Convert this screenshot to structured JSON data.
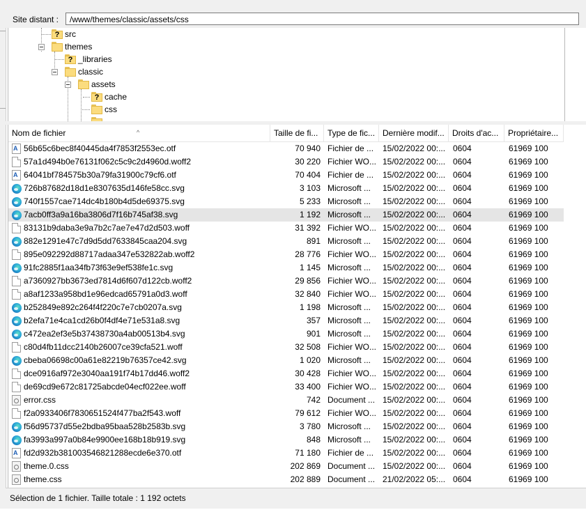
{
  "path_bar": {
    "label": "Site distant :",
    "path": "/www/themes/classic/assets/css"
  },
  "tree": [
    {
      "label": "src",
      "unknown": true
    },
    {
      "label": "themes",
      "unknown": false
    },
    {
      "label": "_libraries",
      "unknown": true
    },
    {
      "label": "classic",
      "unknown": false
    },
    {
      "label": "assets",
      "unknown": false
    },
    {
      "label": "cache",
      "unknown": true
    },
    {
      "label": "css",
      "unknown": false
    }
  ],
  "columns": {
    "name": "Nom de fichier",
    "size": "Taille de fi...",
    "type": "Type de fic...",
    "modified": "Dernière modif...",
    "permissions": "Droits d'ac...",
    "owner": "Propriétaire..."
  },
  "files": [
    {
      "name": "56b65c6bec8f40445da4f7853f2553ec.otf",
      "size": "70 940",
      "type": "Fichier de ...",
      "modified": "15/02/2022 00:...",
      "permissions": "0604",
      "owner": "61969 100",
      "icon": "font-file-icon"
    },
    {
      "name": "57a1d494b0e76131f062c5c9c2d4960d.woff2",
      "size": "30 220",
      "type": "Fichier WO...",
      "modified": "15/02/2022 00:...",
      "permissions": "0604",
      "owner": "61969 100",
      "icon": "document-file-icon"
    },
    {
      "name": "64041bf784575b30a79fa31900c79cf6.otf",
      "size": "70 404",
      "type": "Fichier de ...",
      "modified": "15/02/2022 00:...",
      "permissions": "0604",
      "owner": "61969 100",
      "icon": "font-file-icon"
    },
    {
      "name": "726b87682d18d1e8307635d146fe58cc.svg",
      "size": "3 103",
      "type": "Microsoft ...",
      "modified": "15/02/2022 00:...",
      "permissions": "0604",
      "owner": "61969 100",
      "icon": "edge-browser-icon"
    },
    {
      "name": "740f1557cae714dc4b180b4d5de69375.svg",
      "size": "5 233",
      "type": "Microsoft ...",
      "modified": "15/02/2022 00:...",
      "permissions": "0604",
      "owner": "61969 100",
      "icon": "edge-browser-icon"
    },
    {
      "name": "7acb0ff3a9a16ba3806d7f16b745af38.svg",
      "size": "1 192",
      "type": "Microsoft ...",
      "modified": "15/02/2022 00:...",
      "permissions": "0604",
      "owner": "61969 100",
      "icon": "edge-browser-icon",
      "selected": true
    },
    {
      "name": "83131b9daba3e9a7b2c7ae7e47d2d503.woff",
      "size": "31 392",
      "type": "Fichier WO...",
      "modified": "15/02/2022 00:...",
      "permissions": "0604",
      "owner": "61969 100",
      "icon": "document-file-icon"
    },
    {
      "name": "882e1291e47c7d9d5dd7633845caa204.svg",
      "size": "891",
      "type": "Microsoft ...",
      "modified": "15/02/2022 00:...",
      "permissions": "0604",
      "owner": "61969 100",
      "icon": "edge-browser-icon"
    },
    {
      "name": "895e092292d88717adaa347e532822ab.woff2",
      "size": "28 776",
      "type": "Fichier WO...",
      "modified": "15/02/2022 00:...",
      "permissions": "0604",
      "owner": "61969 100",
      "icon": "document-file-icon"
    },
    {
      "name": "91fc2885f1aa34fb73f63e9ef538fe1c.svg",
      "size": "1 145",
      "type": "Microsoft ...",
      "modified": "15/02/2022 00:...",
      "permissions": "0604",
      "owner": "61969 100",
      "icon": "edge-browser-icon"
    },
    {
      "name": "a7360927bb3673ed7814d6f607d122cb.woff2",
      "size": "29 856",
      "type": "Fichier WO...",
      "modified": "15/02/2022 00:...",
      "permissions": "0604",
      "owner": "61969 100",
      "icon": "document-file-icon"
    },
    {
      "name": "a8af1233a958bd1e96edcad65791a0d3.woff",
      "size": "32 840",
      "type": "Fichier WO...",
      "modified": "15/02/2022 00:...",
      "permissions": "0604",
      "owner": "61969 100",
      "icon": "document-file-icon"
    },
    {
      "name": "b252849e892c264f4f220c7e7cb0207a.svg",
      "size": "1 198",
      "type": "Microsoft ...",
      "modified": "15/02/2022 00:...",
      "permissions": "0604",
      "owner": "61969 100",
      "icon": "edge-browser-icon"
    },
    {
      "name": "b2efa71e4ca1cd26b0f4df4e71e531a8.svg",
      "size": "357",
      "type": "Microsoft ...",
      "modified": "15/02/2022 00:...",
      "permissions": "0604",
      "owner": "61969 100",
      "icon": "edge-browser-icon"
    },
    {
      "name": "c472ea2ef3e5b37438730a4ab00513b4.svg",
      "size": "901",
      "type": "Microsoft ...",
      "modified": "15/02/2022 00:...",
      "permissions": "0604",
      "owner": "61969 100",
      "icon": "edge-browser-icon"
    },
    {
      "name": "c80d4fb11dcc2140b26007ce39cfa521.woff",
      "size": "32 508",
      "type": "Fichier WO...",
      "modified": "15/02/2022 00:...",
      "permissions": "0604",
      "owner": "61969 100",
      "icon": "document-file-icon"
    },
    {
      "name": "cbeba06698c00a61e82219b76357ce42.svg",
      "size": "1 020",
      "type": "Microsoft ...",
      "modified": "15/02/2022 00:...",
      "permissions": "0604",
      "owner": "61969 100",
      "icon": "edge-browser-icon"
    },
    {
      "name": "dce0916af972e3040aa191f74b17dd46.woff2",
      "size": "30 428",
      "type": "Fichier WO...",
      "modified": "15/02/2022 00:...",
      "permissions": "0604",
      "owner": "61969 100",
      "icon": "document-file-icon"
    },
    {
      "name": "de69cd9e672c81725abcde04ecf022ee.woff",
      "size": "33 400",
      "type": "Fichier WO...",
      "modified": "15/02/2022 00:...",
      "permissions": "0604",
      "owner": "61969 100",
      "icon": "document-file-icon"
    },
    {
      "name": "error.css",
      "size": "742",
      "type": "Document ...",
      "modified": "15/02/2022 00:...",
      "permissions": "0604",
      "owner": "61969 100",
      "icon": "css-file-icon"
    },
    {
      "name": "f2a0933406f7830651524f477ba2f543.woff",
      "size": "79 612",
      "type": "Fichier WO...",
      "modified": "15/02/2022 00:...",
      "permissions": "0604",
      "owner": "61969 100",
      "icon": "document-file-icon"
    },
    {
      "name": "f56d95737d55e2bdba95baa528b2583b.svg",
      "size": "3 780",
      "type": "Microsoft ...",
      "modified": "15/02/2022 00:...",
      "permissions": "0604",
      "owner": "61969 100",
      "icon": "edge-browser-icon"
    },
    {
      "name": "fa3993a997a0b84e9900ee168b18b919.svg",
      "size": "848",
      "type": "Microsoft ...",
      "modified": "15/02/2022 00:...",
      "permissions": "0604",
      "owner": "61969 100",
      "icon": "edge-browser-icon"
    },
    {
      "name": "fd2d932b381003546821288ecde6e370.otf",
      "size": "71 180",
      "type": "Fichier de ...",
      "modified": "15/02/2022 00:...",
      "permissions": "0604",
      "owner": "61969 100",
      "icon": "font-file-icon"
    },
    {
      "name": "theme.0.css",
      "size": "202 869",
      "type": "Document ...",
      "modified": "15/02/2022 00:...",
      "permissions": "0604",
      "owner": "61969 100",
      "icon": "css-file-icon"
    },
    {
      "name": "theme.css",
      "size": "202 889",
      "type": "Document ...",
      "modified": "21/02/2022 05:...",
      "permissions": "0604",
      "owner": "61969 100",
      "icon": "css-file-icon"
    }
  ],
  "status": {
    "text": "Sélection de 1 fichier. Taille totale : 1 192 octets"
  }
}
